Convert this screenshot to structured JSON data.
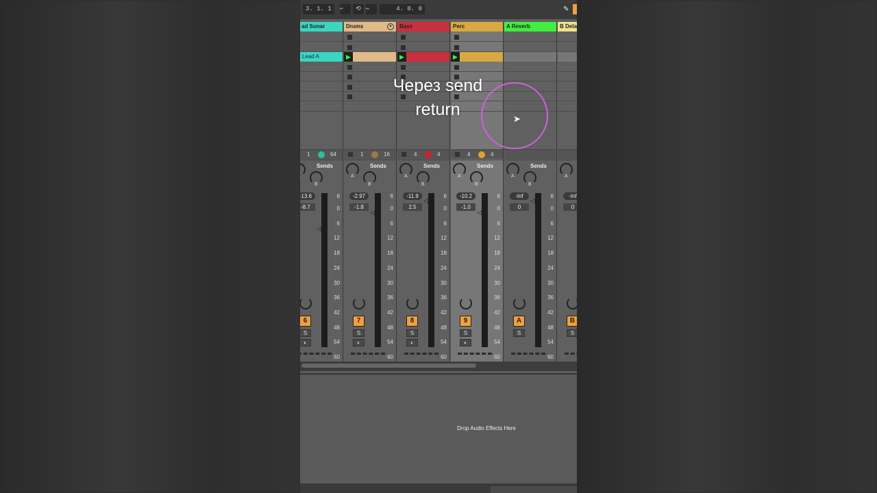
{
  "transport": {
    "position": "3. 1. 1",
    "length": "4. 0. 0"
  },
  "overlay": {
    "line1": "Через send",
    "line2": "return"
  },
  "device_area": {
    "drop_text": "Drop Audio Effects Here"
  },
  "scale": [
    "6",
    "0",
    "6",
    "12",
    "18",
    "24",
    "30",
    "36",
    "42",
    "48",
    "54",
    "60"
  ],
  "sends_label": "Sends",
  "knob_a": "A",
  "knob_b": "B",
  "solo": "S",
  "tracks": [
    {
      "name": "ad Sonar",
      "color": "#3cd6c0",
      "clip": "Lead A",
      "in": "1",
      "out": "64",
      "dot": "#2bbfa4",
      "vol": "-13.6",
      "pan": "-8.7",
      "num": "6",
      "type": "audio"
    },
    {
      "name": "Drums",
      "color": "#e0bb88",
      "in": "1",
      "out": "16",
      "dot": "#9a7a4a",
      "vol": "-2.97",
      "pan": "-1.8",
      "num": "7",
      "type": "audio",
      "fold": true
    },
    {
      "name": "Bass",
      "color": "#c8303f",
      "in": "4",
      "out": "4",
      "dot": "#d0202a",
      "vol": "-11.9",
      "pan": "2.5",
      "num": "8",
      "type": "audio"
    },
    {
      "name": "Perc",
      "color": "#d9a840",
      "in": "4",
      "out": "4",
      "dot": "#e0a030",
      "vol": "-10.2",
      "pan": "-1.0",
      "num": "9",
      "type": "audio",
      "selected": true
    },
    {
      "name": "A Reverb",
      "color": "#40ee40",
      "vol": "-Inf",
      "pan": "0",
      "num": "A",
      "type": "return"
    },
    {
      "name": "B Delay",
      "color": "#f0e090",
      "vol": "-Inf",
      "pan": "0",
      "num": "B",
      "type": "return"
    }
  ]
}
